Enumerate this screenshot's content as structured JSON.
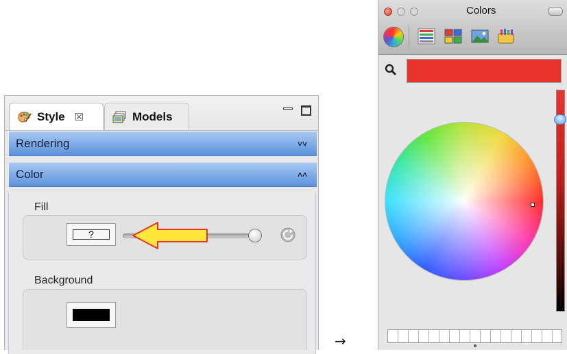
{
  "style_panel": {
    "tabs": [
      {
        "label": "Style",
        "close": "☒",
        "active": true
      },
      {
        "label": "Models",
        "active": false
      }
    ],
    "sections": {
      "rendering": {
        "label": "Rendering",
        "chevron": "»",
        "expanded": false
      },
      "color": {
        "label": "Color",
        "chevron": "«",
        "expanded": true
      }
    },
    "fill": {
      "label": "Fill",
      "swatch_text": "?"
    },
    "background": {
      "label": "Background",
      "swatch_color": "#000000"
    }
  },
  "flow_arrow": "→",
  "colors_window": {
    "title": "Colors",
    "toolbar": [
      "color-wheel-icon",
      "color-sliders-icon",
      "color-palettes-icon",
      "image-palettes-icon",
      "crayons-icon"
    ],
    "selected_color": "#e8332d",
    "brightness_bar_color": "#e8332d"
  },
  "colors": {
    "accent_header": "#5b92dc",
    "arrow_fill": "#ffe63a",
    "arrow_stroke": "#e8332d"
  }
}
